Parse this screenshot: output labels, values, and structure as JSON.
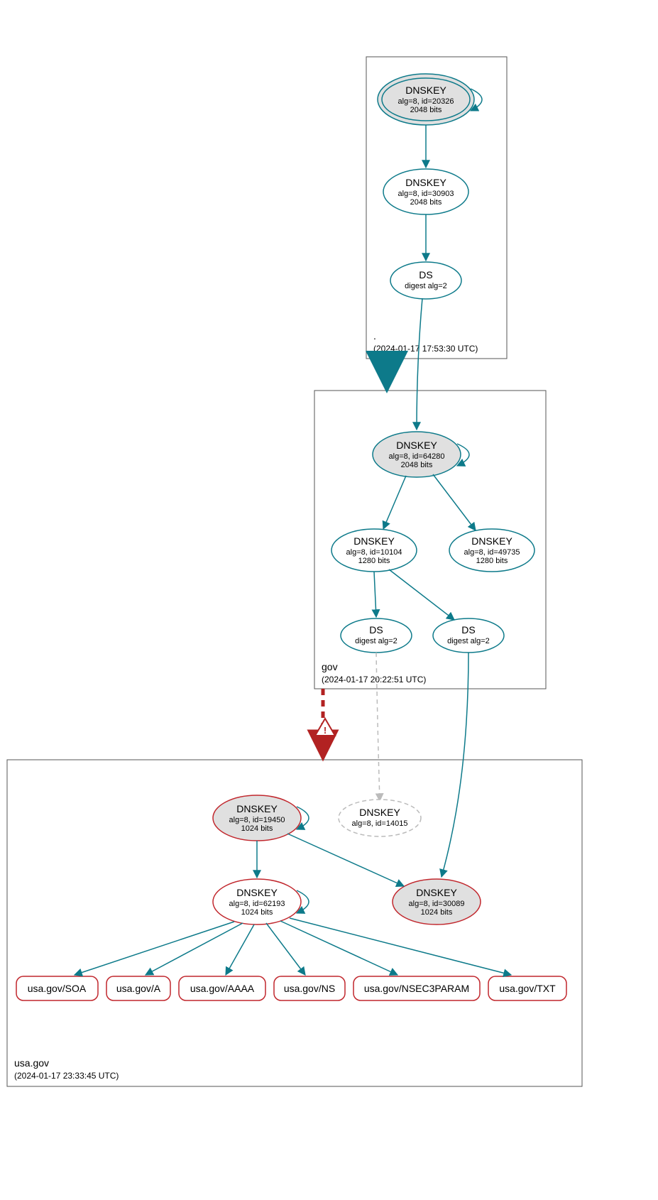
{
  "zones": {
    "root": {
      "name": ".",
      "timestamp": "(2024-01-17 17:53:30 UTC)"
    },
    "gov": {
      "name": "gov",
      "timestamp": "(2024-01-17 20:22:51 UTC)"
    },
    "usa": {
      "name": "usa.gov",
      "timestamp": "(2024-01-17 23:33:45 UTC)"
    }
  },
  "nodes": {
    "root_ksk": {
      "title": "DNSKEY",
      "line2": "alg=8, id=20326",
      "line3": "2048 bits"
    },
    "root_zsk": {
      "title": "DNSKEY",
      "line2": "alg=8, id=30903",
      "line3": "2048 bits"
    },
    "root_ds": {
      "title": "DS",
      "line2": "digest alg=2"
    },
    "gov_ksk": {
      "title": "DNSKEY",
      "line2": "alg=8, id=64280",
      "line3": "2048 bits"
    },
    "gov_zsk1": {
      "title": "DNSKEY",
      "line2": "alg=8, id=10104",
      "line3": "1280 bits"
    },
    "gov_zsk2": {
      "title": "DNSKEY",
      "line2": "alg=8, id=49735",
      "line3": "1280 bits"
    },
    "gov_ds1": {
      "title": "DS",
      "line2": "digest alg=2"
    },
    "gov_ds2": {
      "title": "DS",
      "line2": "digest alg=2"
    },
    "usa_ksk": {
      "title": "DNSKEY",
      "line2": "alg=8, id=19450",
      "line3": "1024 bits"
    },
    "usa_miss": {
      "title": "DNSKEY",
      "line2": "alg=8, id=14015"
    },
    "usa_zsk": {
      "title": "DNSKEY",
      "line2": "alg=8, id=62193",
      "line3": "1024 bits"
    },
    "usa_key2": {
      "title": "DNSKEY",
      "line2": "alg=8, id=30089",
      "line3": "1024 bits"
    },
    "rr_soa": {
      "title": "usa.gov/SOA"
    },
    "rr_a": {
      "title": "usa.gov/A"
    },
    "rr_aaaa": {
      "title": "usa.gov/AAAA"
    },
    "rr_ns": {
      "title": "usa.gov/NS"
    },
    "rr_nsec": {
      "title": "usa.gov/NSEC3PARAM"
    },
    "rr_txt": {
      "title": "usa.gov/TXT"
    }
  },
  "colors": {
    "teal": "#0d7a8a",
    "red": "#c1272d",
    "grayFill": "#e0e0e0"
  }
}
